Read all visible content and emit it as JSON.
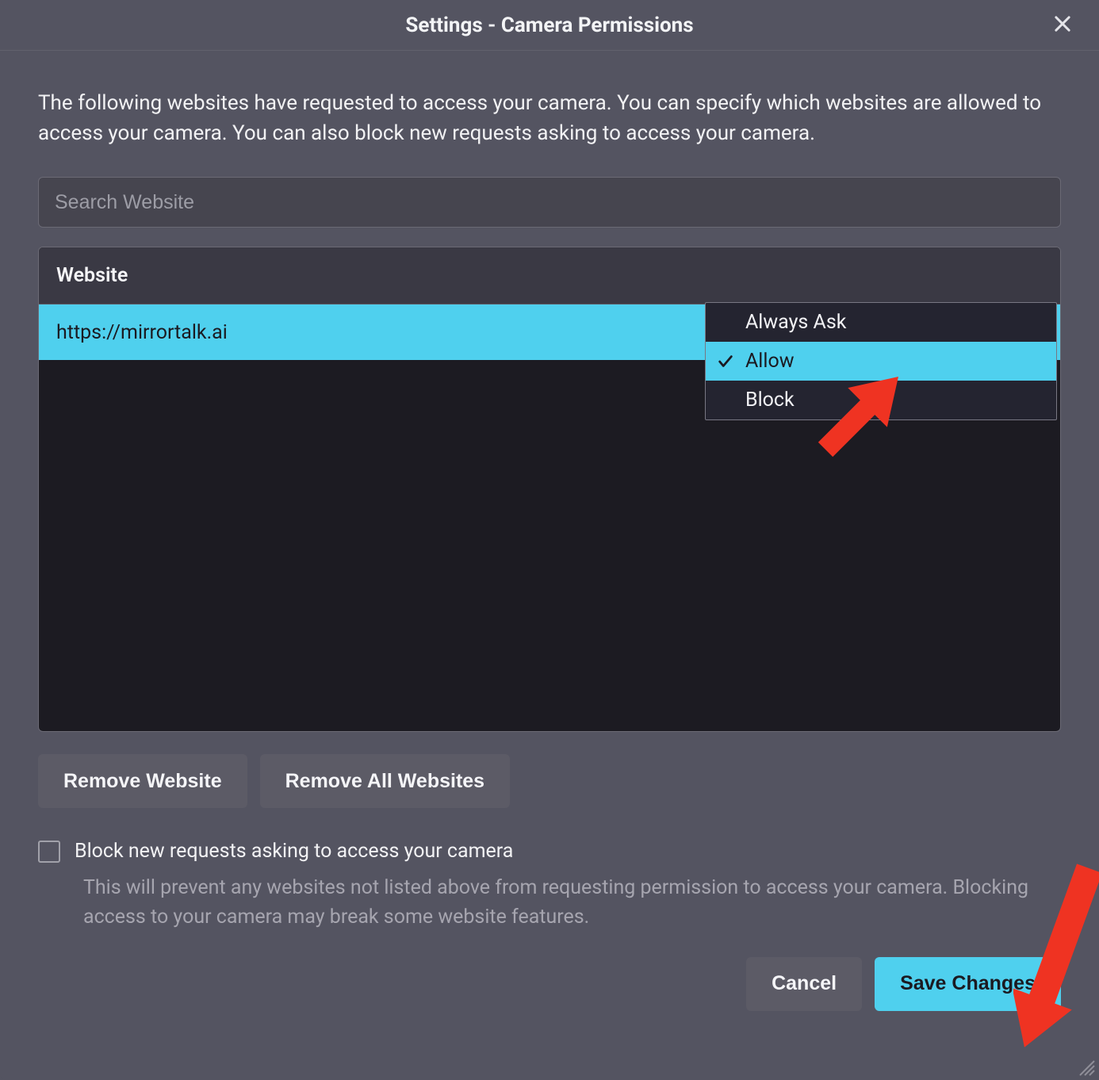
{
  "title": "Settings - Camera Permissions",
  "description": "The following websites have requested to access your camera. You can specify which websites are allowed to access your camera. You can also block new requests asking to access your camera.",
  "search": {
    "value": "",
    "placeholder": "Search Website"
  },
  "table": {
    "headers": {
      "website": "Website"
    },
    "rows": [
      {
        "website": "https://mirrortalk.ai",
        "status": "Allow",
        "selected": true
      }
    ]
  },
  "dropdown": {
    "options": [
      {
        "label": "Always Ask",
        "selected": false
      },
      {
        "label": "Allow",
        "selected": true
      },
      {
        "label": "Block",
        "selected": false
      }
    ]
  },
  "buttons": {
    "remove_website": "Remove Website",
    "remove_all": "Remove All Websites",
    "cancel": "Cancel",
    "save": "Save Changes"
  },
  "checkbox": {
    "checked": false,
    "label": "Block new requests asking to access your camera",
    "help": "This will prevent any websites not listed above from requesting permission to access your camera. Blocking access to your camera may break some website features."
  },
  "colors": {
    "accent": "#4fd0ee",
    "background": "#545461",
    "table_bg": "#1c1b22",
    "annotation": "#ef3322"
  }
}
